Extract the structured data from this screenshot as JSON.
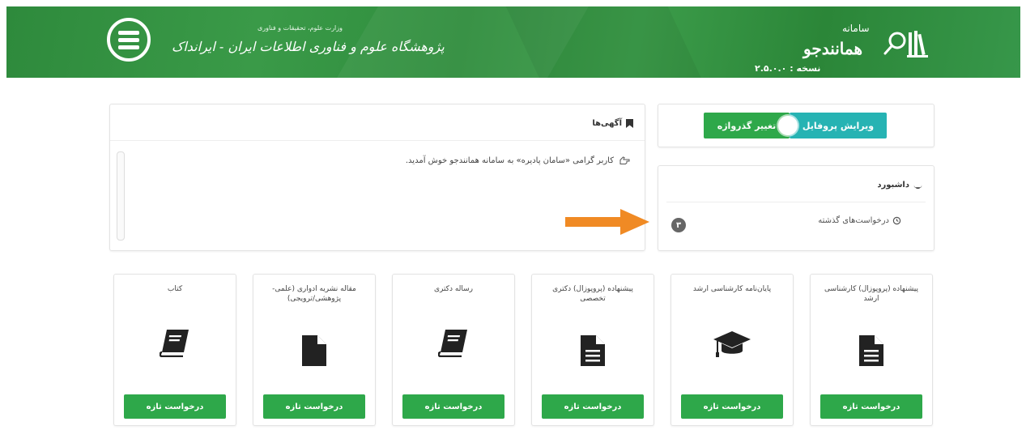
{
  "header": {
    "institute_small": "وزارت علوم، تحقیقات و فناوری",
    "institute_name": "پژوهشگاه علوم و فناوری اطلاعات ایران - ایرانداک",
    "app_prefix": "سامانه",
    "app_name": "همانندجو",
    "version": "نسخه : ۲.۵.۰.۰"
  },
  "profile": {
    "edit_label": "ویرایش پروفایل",
    "password_label": "تغییر گذرواژه"
  },
  "dashboard": {
    "title": "داشبورد",
    "past_requests_label": "درخواست‌های گذشته",
    "past_requests_count": "۳"
  },
  "ads": {
    "title": "آگهی‌ها",
    "message": "کاربر گرامی «سامان پادیره» به سامانه همانندجو خوش آمدید."
  },
  "cards": [
    {
      "title": "پیشنهاده (پروپوزال) کارشناسی ارشد",
      "icon": "file-icon",
      "button": "درخواست تازه"
    },
    {
      "title": "پایان‌نامه کارشناسی ارشد",
      "icon": "graduation-cap-icon",
      "button": "درخواست تازه"
    },
    {
      "title": "پیشنهاده (پروپوزال) دکتری تخصصی",
      "icon": "file-icon",
      "button": "درخواست تازه"
    },
    {
      "title": "رساله دکتری",
      "icon": "book-icon",
      "button": "درخواست تازه"
    },
    {
      "title": "مقاله نشریه ادواری (علمی-پژوهشی/ترویجی)",
      "icon": "file-icon",
      "button": "درخواست تازه"
    },
    {
      "title": "کتاب",
      "icon": "book-icon",
      "button": "درخواست تازه"
    }
  ],
  "colors": {
    "header_green": "#2e8a3c",
    "button_green": "#2ea84a",
    "teal": "#26b3b3",
    "arrow_orange": "#f08a24"
  }
}
